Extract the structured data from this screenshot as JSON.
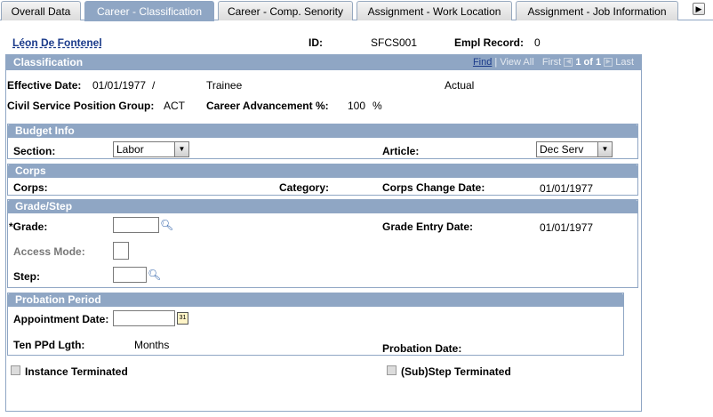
{
  "tabs": [
    {
      "label": "Overall Data"
    },
    {
      "label": "Career - Classification"
    },
    {
      "label": "Career - Comp. Senority"
    },
    {
      "label": "Assignment - Work Location"
    },
    {
      "label": "Assignment - Job Information"
    }
  ],
  "header": {
    "employee_name": "Léon De Fontenel",
    "id_label": "ID:",
    "id_value": "SFCS001",
    "empl_record_label": "Empl Record:",
    "empl_record_value": "0"
  },
  "classification": {
    "title": "Classification",
    "nav": {
      "find": "Find",
      "view_all": "View All",
      "first": "First",
      "range": "1 of 1",
      "last": "Last"
    },
    "effective_date_label": "Effective Date:",
    "effective_date_value": "01/01/1977",
    "slash": "/",
    "status": "Trainee",
    "actual": "Actual",
    "civil_service_label": "Civil Service Position Group:",
    "civil_service_value": "ACT",
    "career_adv_label": "Career Advancement %:",
    "career_adv_value": "100",
    "percent": "%"
  },
  "budget": {
    "title": "Budget Info",
    "section_label": "Section:",
    "section_value": "Labor",
    "article_label": "Article:",
    "article_value": "Dec Serv"
  },
  "corps": {
    "title": "Corps",
    "corps_label": "Corps:",
    "category_label": "Category:",
    "change_date_label": "Corps Change Date:",
    "change_date_value": "01/01/1977"
  },
  "grade": {
    "title": "Grade/Step",
    "grade_label": "*Grade:",
    "grade_value": "",
    "entry_date_label": "Grade Entry Date:",
    "entry_date_value": "01/01/1977",
    "access_mode_label": "Access Mode:",
    "step_label": "Step:",
    "step_value": ""
  },
  "probation": {
    "title": "Probation Period",
    "appointment_label": "Appointment Date:",
    "appointment_value": "",
    "ten_ppd_label": "Ten PPd Lgth:",
    "months": "Months",
    "probation_date_label": "Probation Date:"
  },
  "checks": {
    "instance_terminated": "Instance Terminated",
    "substep_terminated": "(Sub)Step Terminated"
  }
}
